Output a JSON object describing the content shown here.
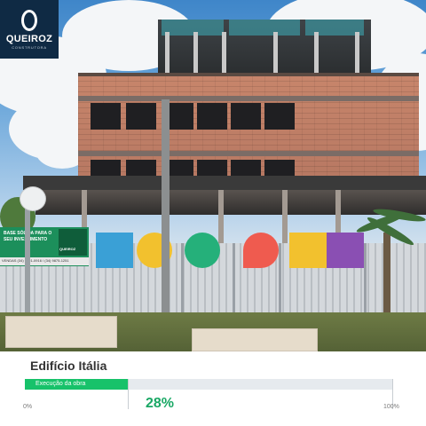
{
  "brand": {
    "name": "QUEIROZ",
    "tagline": "CONSTRUTORA",
    "color": "#0f2a44"
  },
  "photo": {
    "banner_text": "BASE SÓLIDA PARA O SEU INVESTIMENTO",
    "banner_logo": "QUEIROZ",
    "banner_phones": "VENDAS (34) 9821-0916 / (34) 9875-1251",
    "signs": [
      {
        "icon": "excavator-icon",
        "color": "#3aa0d6"
      },
      {
        "icon": "blueprint-icon",
        "color": "#f2c12e"
      },
      {
        "icon": "bullet-list-icon",
        "color": "#25b07a"
      },
      {
        "icon": "bullet-list-icon",
        "color": "#ef5b4f"
      },
      {
        "icon": "concrete-mixer-icon",
        "color": "#f2c12e"
      },
      {
        "icon": "worker-icon",
        "color": "#8a4fb3"
      }
    ]
  },
  "project": {
    "title": "Edifício Itália",
    "progress_label": "Execução da obra",
    "progress": 0.28,
    "progress_text": "28%",
    "min_label": "0%",
    "max_label": "100%",
    "accent": "#17c26a"
  }
}
